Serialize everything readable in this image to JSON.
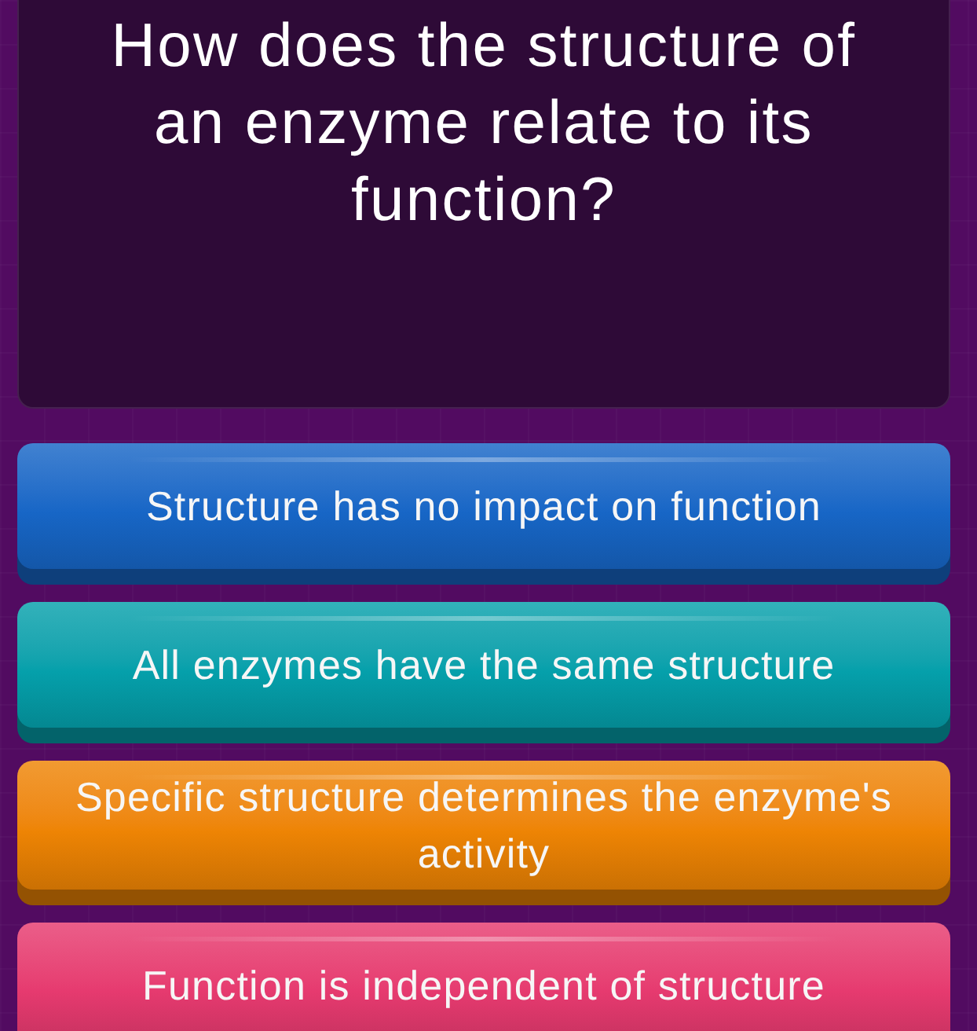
{
  "question": {
    "text": "How does the structure of an enzyme relate to its function?"
  },
  "answers": [
    {
      "text": "Structure has no impact on function",
      "color": "#1766c6"
    },
    {
      "text": "All enzymes have the same structure",
      "color": "#05a0ab"
    },
    {
      "text": "Specific structure determines the enzyme's activity",
      "color": "#ee8404"
    },
    {
      "text": "Function is independent of structure",
      "color": "#e63a6f"
    }
  ]
}
